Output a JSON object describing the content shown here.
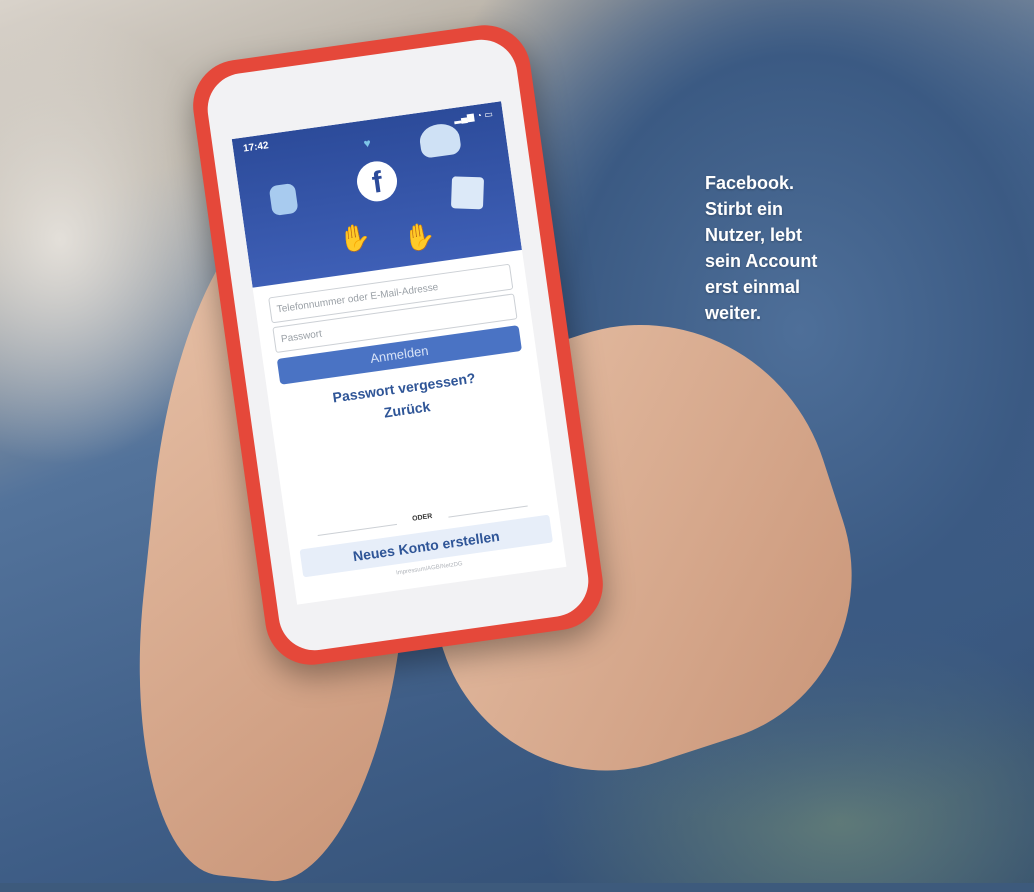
{
  "caption": {
    "line1": "Facebook.",
    "line2": "Stirbt ein",
    "line3": "Nutzer, lebt",
    "line4": "sein Account",
    "line5": "erst einmal",
    "line6": "weiter."
  },
  "phone": {
    "status_time": "17:42",
    "status_icons": "▂▄▆ ◔ ▭",
    "logo_letter": "f",
    "phone_placeholder": "Telefonnummer oder E-Mail-Adresse",
    "password_placeholder": "Passwort",
    "login_label": "Anmelden",
    "forgot_label": "Passwort vergessen?",
    "back_label": "Zurück",
    "or_label": "ODER",
    "create_label": "Neues Konto erstellen",
    "impressum": "Impressum/AGB/NetzDG"
  },
  "colors": {
    "case": "#e5483a",
    "facebook_blue": "#2c4b9a",
    "login_button": "#4a73c4",
    "caption_text": "#ffffff"
  }
}
